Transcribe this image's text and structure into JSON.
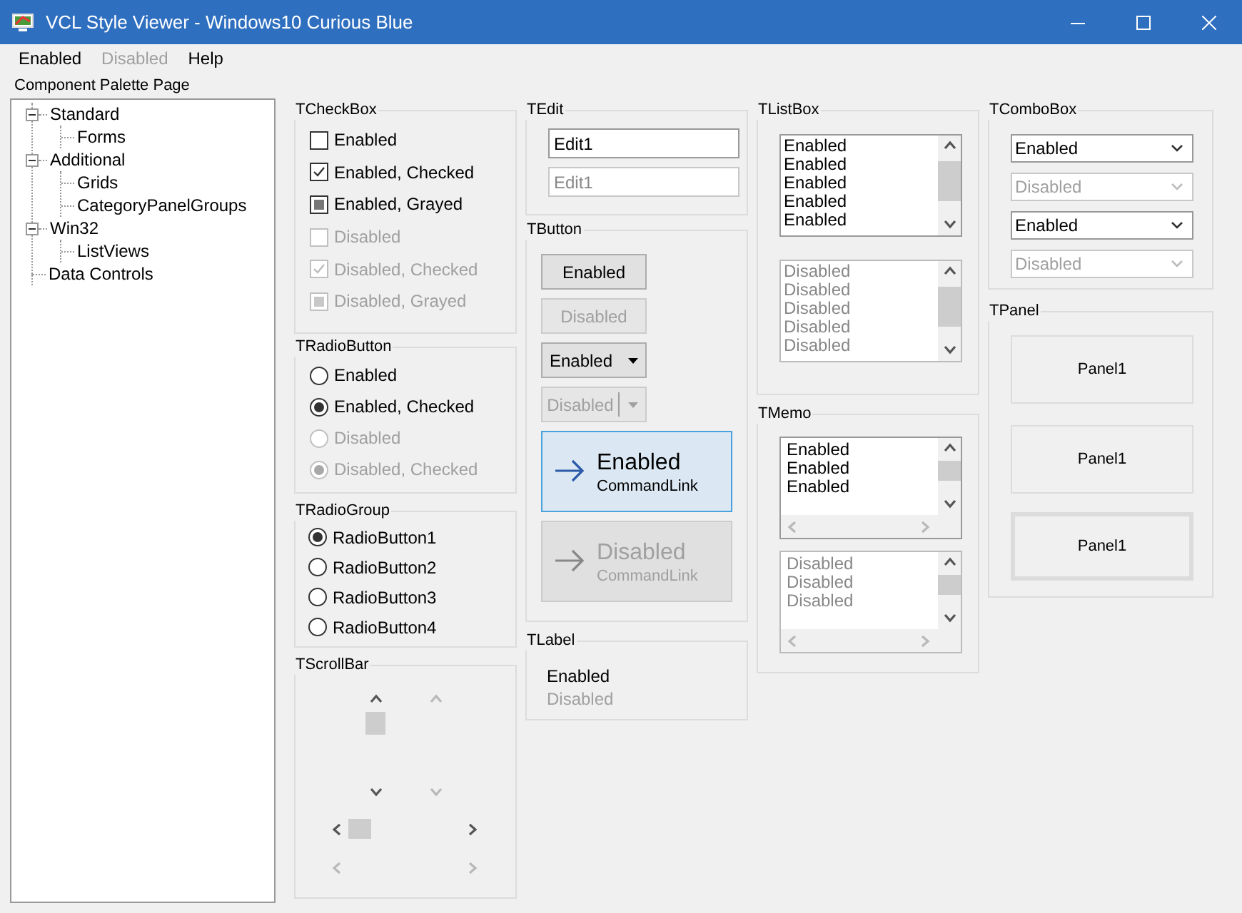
{
  "window": {
    "title": "VCL Style Viewer - Windows10 Curious Blue"
  },
  "menu": [
    {
      "label": "Enabled",
      "disabled": false
    },
    {
      "label": "Disabled",
      "disabled": true
    },
    {
      "label": "Help",
      "disabled": false
    }
  ],
  "palette": {
    "label": "Component Palette Page",
    "tree": [
      {
        "label": "Standard",
        "expanded": true,
        "children": [
          {
            "label": "Forms"
          }
        ]
      },
      {
        "label": "Additional",
        "expanded": true,
        "children": [
          {
            "label": "Grids"
          },
          {
            "label": "CategoryPanelGroups"
          }
        ]
      },
      {
        "label": "Win32",
        "expanded": true,
        "children": [
          {
            "label": "ListViews"
          }
        ]
      },
      {
        "label": "Data Controls"
      }
    ]
  },
  "check_boxes": {
    "title": "TCheckBox",
    "items": [
      {
        "label": "Enabled",
        "checked": false,
        "grayed": false,
        "disabled": false
      },
      {
        "label": "Enabled, Checked",
        "checked": true,
        "grayed": false,
        "disabled": false
      },
      {
        "label": "Enabled, Grayed",
        "checked": false,
        "grayed": true,
        "disabled": false
      },
      {
        "label": "Disabled",
        "checked": false,
        "grayed": false,
        "disabled": true
      },
      {
        "label": "Disabled, Checked",
        "checked": true,
        "grayed": false,
        "disabled": true
      },
      {
        "label": "Disabled, Grayed",
        "checked": false,
        "grayed": true,
        "disabled": true
      }
    ]
  },
  "radio_buttons": {
    "title": "TRadioButton",
    "items": [
      {
        "label": "Enabled",
        "checked": false,
        "disabled": false
      },
      {
        "label": "Enabled, Checked",
        "checked": true,
        "disabled": false
      },
      {
        "label": "Disabled",
        "checked": false,
        "disabled": true
      },
      {
        "label": "Disabled, Checked",
        "checked": true,
        "disabled": true
      }
    ]
  },
  "radio_group": {
    "title": "TRadioGroup",
    "items": [
      {
        "label": "RadioButton1",
        "selected": true
      },
      {
        "label": "RadioButton2",
        "selected": false
      },
      {
        "label": "RadioButton3",
        "selected": false
      },
      {
        "label": "RadioButton4",
        "selected": false
      }
    ]
  },
  "scroll_bars": {
    "title": "TScrollBar",
    "items": [
      {
        "vertical": true,
        "disabled": false
      },
      {
        "vertical": true,
        "disabled": true
      },
      {
        "vertical": false,
        "disabled": false
      },
      {
        "vertical": false,
        "disabled": true
      }
    ]
  },
  "edits": {
    "title": "TEdit",
    "items": [
      {
        "value": "Edit1",
        "disabled": false
      },
      {
        "value": "Edit1",
        "disabled": true
      }
    ]
  },
  "buttons": {
    "title": "TButton",
    "items": [
      {
        "kind": "push",
        "label": "Enabled",
        "disabled": false
      },
      {
        "kind": "push",
        "label": "Disabled",
        "disabled": true
      },
      {
        "kind": "split",
        "label": "Enabled",
        "disabled": false
      },
      {
        "kind": "split",
        "label": "Disabled",
        "disabled": true
      },
      {
        "kind": "command_link",
        "label": "Enabled",
        "note": "CommandLink",
        "disabled": false
      },
      {
        "kind": "command_link",
        "label": "Disabled",
        "note": "CommandLink",
        "disabled": true
      }
    ]
  },
  "labels": {
    "title": "TLabel",
    "items": [
      {
        "text": "Enabled",
        "disabled": false
      },
      {
        "text": "Disabled",
        "disabled": true
      }
    ]
  },
  "list_boxes": {
    "title": "TListBox",
    "items": [
      {
        "disabled": false,
        "entries": [
          "Enabled",
          "Enabled",
          "Enabled",
          "Enabled",
          "Enabled"
        ]
      },
      {
        "disabled": true,
        "entries": [
          "Disabled",
          "Disabled",
          "Disabled",
          "Disabled",
          "Disabled"
        ]
      }
    ]
  },
  "memos": {
    "title": "TMemo",
    "items": [
      {
        "disabled": false,
        "lines": [
          "Enabled",
          "Enabled",
          "Enabled"
        ]
      },
      {
        "disabled": true,
        "lines": [
          "Disabled",
          "Disabled",
          "Disabled"
        ]
      }
    ]
  },
  "combo_boxes": {
    "title": "TComboBox",
    "items": [
      {
        "value": "Enabled",
        "disabled": false
      },
      {
        "value": "Disabled",
        "disabled": true
      },
      {
        "value": "Enabled",
        "disabled": false
      },
      {
        "value": "Disabled",
        "disabled": true
      }
    ]
  },
  "panels": {
    "title": "TPanel",
    "items": [
      {
        "caption": "Panel1",
        "kind": "flat"
      },
      {
        "caption": "Panel1",
        "kind": "flat"
      },
      {
        "caption": "Panel1",
        "kind": "bevel"
      }
    ]
  }
}
